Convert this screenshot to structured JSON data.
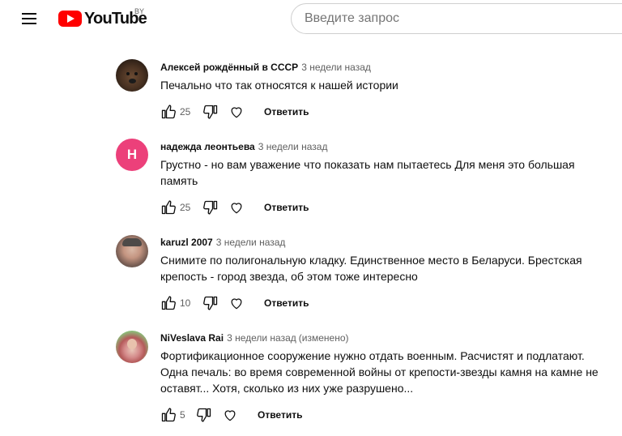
{
  "header": {
    "logo_text": "YouTube",
    "country_code": "BY",
    "search_placeholder": "Введите запрос"
  },
  "comments": [
    {
      "author": "Алексей рождённый в СССР",
      "time": "3 недели назад",
      "edited": "",
      "text": "Печально что так относятся к нашей истории",
      "likes": "25",
      "reply_label": "Ответить",
      "avatar": "bear-photo"
    },
    {
      "author": "надежда леонтьева",
      "time": "3 недели назад",
      "edited": "",
      "text": "Грустно - но вам уважение что показать нам пытаетесь Для меня это большая память",
      "likes": "25",
      "reply_label": "Ответить",
      "avatar": "letter",
      "avatar_letter": "Н",
      "avatar_color": "#ec407a"
    },
    {
      "author": "karuzl 2007",
      "time": "3 недели назад",
      "edited": "",
      "text": "Снимите по полигональную кладку. Единственное место в Беларуси. Брестская крепость - город звезда, об этом тоже интересно",
      "likes": "10",
      "reply_label": "Ответить",
      "avatar": "man-photo"
    },
    {
      "author": "NiVeslava Rai",
      "time": "3 недели назад",
      "edited": "(изменено)",
      "text": "Фортификационное сооружение нужно отдать военным. Расчистят и подлатают. Одна печаль: во время современной войны от крепости-звезды камня на камне не оставят... Хотя, сколько из них уже разрушено...",
      "likes": "5",
      "reply_label": "Ответить",
      "avatar": "woman-photo"
    }
  ],
  "colors": {
    "brand_red": "#ff0000",
    "secondary_text": "#606060",
    "primary_text": "#0f0f0f"
  },
  "icons": [
    "menu-icon",
    "youtube-logo-icon",
    "thumbs-up-icon",
    "thumbs-down-icon",
    "heart-icon"
  ]
}
